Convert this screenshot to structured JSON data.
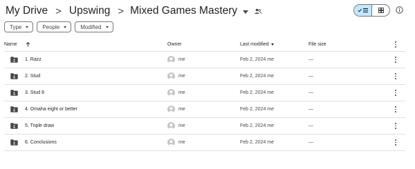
{
  "breadcrumb": {
    "items": [
      "My Drive",
      "Upswing"
    ],
    "separator": ">",
    "current": "Mixed Games Mastery"
  },
  "icons": {
    "shared": "shared-folder-people-icon",
    "list_view": "list-view-icon",
    "grid_view": "grid-view-icon",
    "info": "info-icon",
    "folder": "shared-folder-icon",
    "more": "more-vert-icon",
    "sort": "arrow-up-icon"
  },
  "colors": {
    "active_toggle": "#c2e7ff",
    "folder": "#444746",
    "avatar": "#c4c7c5"
  },
  "filters": [
    {
      "label": "Type"
    },
    {
      "label": "People"
    },
    {
      "label": "Modified"
    }
  ],
  "table": {
    "headers": {
      "name": "Name",
      "owner": "Owner",
      "last_modified": "Last modified",
      "file_size": "File size"
    },
    "rows": [
      {
        "name": "1. Razz",
        "owner": "me",
        "modified": "Feb 2, 2024 me",
        "size": "—"
      },
      {
        "name": "2. Stud",
        "owner": "me",
        "modified": "Feb 2, 2024 me",
        "size": "—"
      },
      {
        "name": "3. Stud 8",
        "owner": "me",
        "modified": "Feb 2, 2024 me",
        "size": "—"
      },
      {
        "name": "4. Omaha eight or better",
        "owner": "me",
        "modified": "Feb 2, 2024 me",
        "size": "—"
      },
      {
        "name": "5. Triple draw",
        "owner": "me",
        "modified": "Feb 2, 2024 me",
        "size": "—"
      },
      {
        "name": "6. Conclusions",
        "owner": "me",
        "modified": "Feb 2, 2024 me",
        "size": "—"
      }
    ]
  }
}
